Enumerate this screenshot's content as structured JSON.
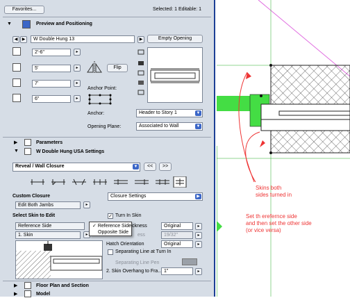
{
  "top": {
    "favorites_label": "Favorites...",
    "selected_info": "Selected: 1 Editable: 1"
  },
  "preview_section": {
    "title": "Preview and Positioning",
    "window_name": "W Double Hung 13",
    "empty_opening": "Empty Opening",
    "width_value": "2'-6\"",
    "height_value": "5'",
    "sill_value": "7'",
    "depth_value": "6\"",
    "flip_label": "Flip",
    "anchor_point_label": "Anchor Point:",
    "anchor_label": "Anchor:",
    "anchor_value": "Header to Story 1",
    "opening_plane_label": "Opening Plane:",
    "opening_plane_value": "Associated to Wall"
  },
  "parameters_title": "Parameters",
  "settings_title": "W Double Hung USA Settings",
  "reveal": {
    "dropdown_value": "Reveal / Wall Closure",
    "prev": "<<",
    "next": ">>",
    "custom_closure_label": "Custom Closure",
    "closure_settings": "Closure Settings",
    "edit_jambs": "Edit Both Jambs",
    "select_skin_label": "Select Skin to Edit",
    "skin_side_value": "Reference Side",
    "skin_value": "1. Skin",
    "turn_in_skin_label": "Turn In Skin",
    "thickness_label": "ckness",
    "thickness_value": "Original",
    "dim_field_label": "ess",
    "dim_field_value": "19/32\"",
    "hatch_label": "Hatch Orientation",
    "hatch_value": "Original",
    "sep_line_label": "Separating Line at Turn In",
    "sep_pen_label": "Separating Line Pen",
    "overhang_label": "2. Skin Overhang to Fra...",
    "overhang_value": "1\""
  },
  "menu": {
    "items": [
      "Reference Side",
      "Opposite Side"
    ],
    "checked": "Reference Side"
  },
  "bottom": {
    "floor_plan_title": "Floor Plan and Section",
    "model_title": "Model"
  },
  "annotations": {
    "note1": "Skins both\nsides turned in",
    "note2": "Set th erefernce side\nand then set the other side\n(or vice versa)"
  },
  "colors": {
    "accent": "#1c3f95",
    "annotation": "#e33333",
    "wall_green": "#44dd44"
  }
}
